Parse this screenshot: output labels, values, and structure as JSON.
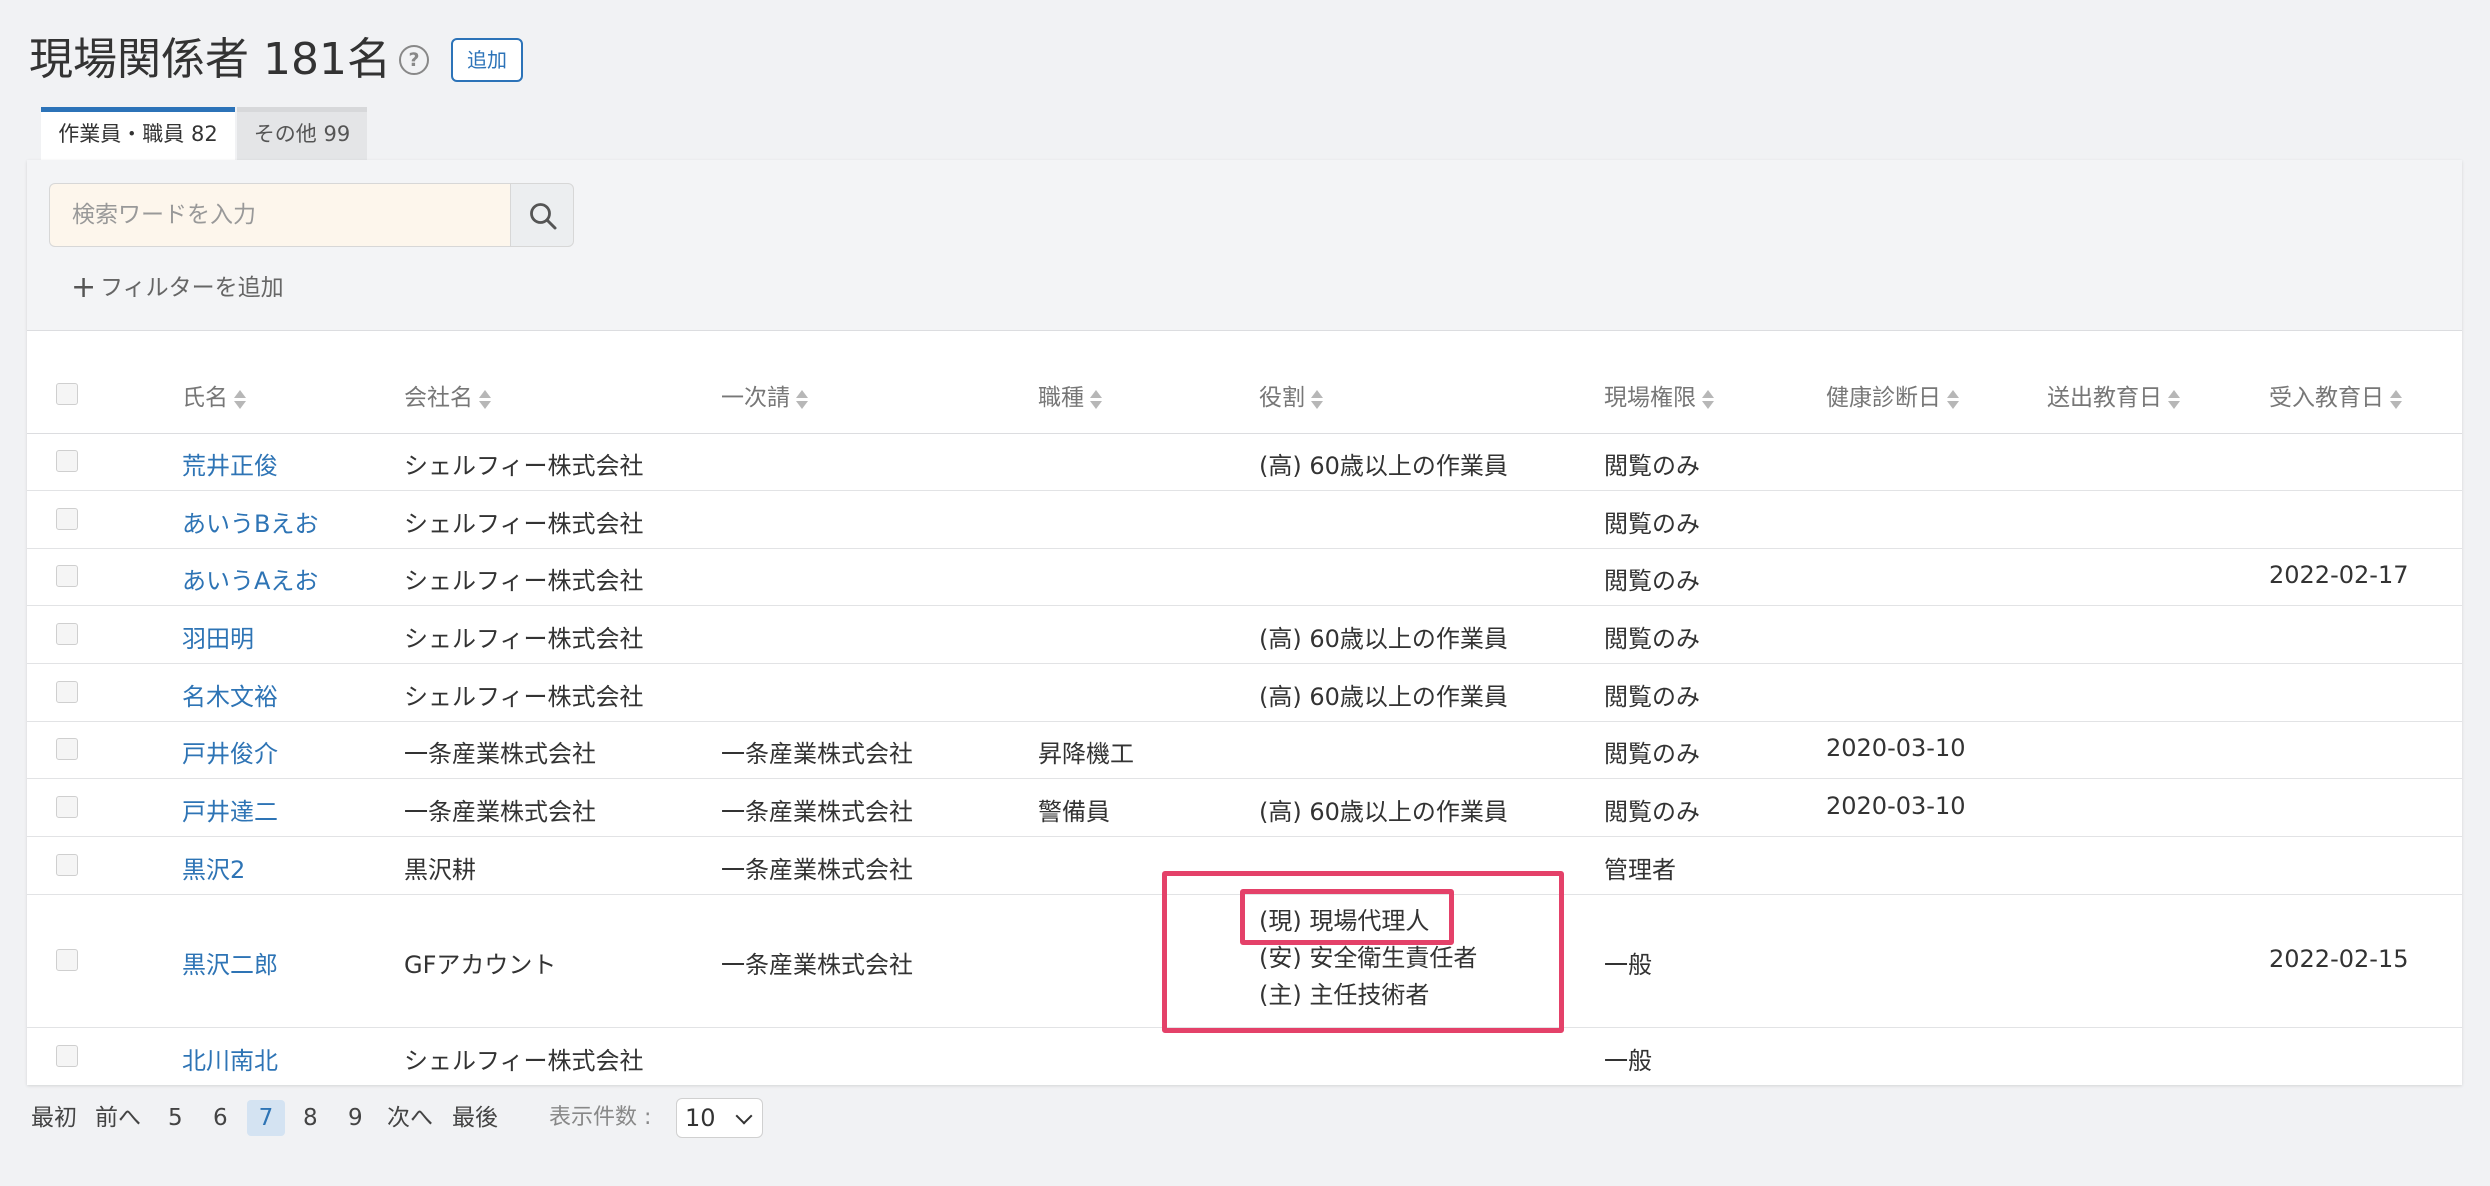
{
  "header": {
    "title": "現場関係者 181名",
    "help_icon": "question-circle-icon",
    "add_label": "追加"
  },
  "tabs": [
    {
      "label": "作業員・職員 82",
      "active": true
    },
    {
      "label": "その他 99",
      "active": false
    }
  ],
  "search": {
    "placeholder": "検索ワードを入力",
    "value": "",
    "button_icon": "search-icon"
  },
  "filter": {
    "add_label": "フィルターを追加",
    "icon": "plus-icon"
  },
  "columns": [
    "氏名",
    "会社名",
    "一次請",
    "職種",
    "役割",
    "現場権限",
    "健康診断日",
    "送出教育日",
    "受入教育日"
  ],
  "rows": [
    {
      "name": "荒井正俊",
      "company": "シェルフィー株式会社",
      "primary": "",
      "job": "",
      "roles": [
        "(高) 60歳以上の作業員"
      ],
      "permission": "閲覧のみ",
      "health": "",
      "send_edu": "",
      "recv_edu": ""
    },
    {
      "name": "あいうBえお",
      "company": "シェルフィー株式会社",
      "primary": "",
      "job": "",
      "roles": [],
      "permission": "閲覧のみ",
      "health": "",
      "send_edu": "",
      "recv_edu": ""
    },
    {
      "name": "あいうAえお",
      "company": "シェルフィー株式会社",
      "primary": "",
      "job": "",
      "roles": [],
      "permission": "閲覧のみ",
      "health": "",
      "send_edu": "",
      "recv_edu": "2022-02-17"
    },
    {
      "name": "羽田明",
      "company": "シェルフィー株式会社",
      "primary": "",
      "job": "",
      "roles": [
        "(高) 60歳以上の作業員"
      ],
      "permission": "閲覧のみ",
      "health": "",
      "send_edu": "",
      "recv_edu": ""
    },
    {
      "name": "名木文裕",
      "company": "シェルフィー株式会社",
      "primary": "",
      "job": "",
      "roles": [
        "(高) 60歳以上の作業員"
      ],
      "permission": "閲覧のみ",
      "health": "",
      "send_edu": "",
      "recv_edu": ""
    },
    {
      "name": "戸井俊介",
      "company": "一条産業株式会社",
      "primary": "一条産業株式会社",
      "job": "昇降機工",
      "roles": [],
      "permission": "閲覧のみ",
      "health": "2020-03-10",
      "send_edu": "",
      "recv_edu": ""
    },
    {
      "name": "戸井達二",
      "company": "一条産業株式会社",
      "primary": "一条産業株式会社",
      "job": "警備員",
      "roles": [
        "(高) 60歳以上の作業員"
      ],
      "permission": "閲覧のみ",
      "health": "2020-03-10",
      "send_edu": "",
      "recv_edu": ""
    },
    {
      "name": "黒沢2",
      "company": "黒沢耕",
      "primary": "一条産業株式会社",
      "job": "",
      "roles": [],
      "permission": "管理者",
      "health": "",
      "send_edu": "",
      "recv_edu": ""
    },
    {
      "name": "黒沢二郎",
      "company": "GFアカウント",
      "primary": "一条産業株式会社",
      "job": "",
      "roles": [
        "(現) 現場代理人",
        "(安) 安全衛生責任者",
        "(主) 主任技術者"
      ],
      "permission": "一般",
      "health": "",
      "send_edu": "",
      "recv_edu": "2022-02-15"
    },
    {
      "name": "北川南北",
      "company": "シェルフィー株式会社",
      "primary": "",
      "job": "",
      "roles": [],
      "permission": "一般",
      "health": "",
      "send_edu": "",
      "recv_edu": ""
    }
  ],
  "pagination": {
    "first": "最初",
    "prev": "前へ",
    "pages": [
      "5",
      "6",
      "7",
      "8",
      "9"
    ],
    "current": "7",
    "next": "次へ",
    "last": "最後",
    "per_page_label": "表示件数 :",
    "per_page_value": "10"
  },
  "colors": {
    "accent": "#2c73b8",
    "link": "#2e74b5",
    "highlight": "#e44169",
    "search_bg": "#fdf6ec"
  }
}
